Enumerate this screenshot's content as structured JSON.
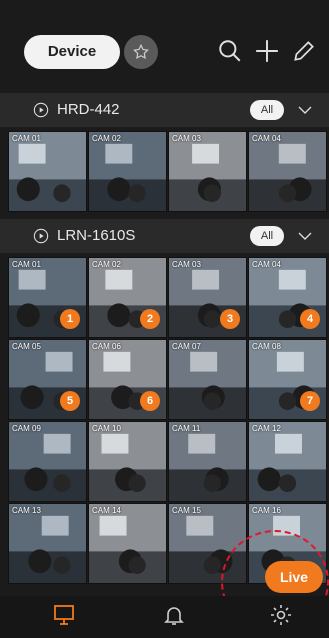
{
  "header": {
    "device_label": "Device",
    "icons": [
      "star-icon",
      "search-icon",
      "plus-icon",
      "pencil-icon"
    ]
  },
  "groups": [
    {
      "name": "HRD-442",
      "all_label": "All",
      "cameras": [
        {
          "label": "CAM 01",
          "badge": ""
        },
        {
          "label": "CAM 02",
          "badge": ""
        },
        {
          "label": "CAM 03",
          "badge": ""
        },
        {
          "label": "CAM 04",
          "badge": ""
        }
      ]
    },
    {
      "name": "LRN-1610S",
      "all_label": "All",
      "cameras": [
        {
          "label": "CAM 01",
          "badge": "1"
        },
        {
          "label": "CAM 02",
          "badge": "2"
        },
        {
          "label": "CAM 03",
          "badge": "3"
        },
        {
          "label": "CAM 04",
          "badge": "4"
        },
        {
          "label": "CAM 05",
          "badge": "5"
        },
        {
          "label": "CAM 06",
          "badge": "6"
        },
        {
          "label": "CAM 07",
          "badge": ""
        },
        {
          "label": "CAM 08",
          "badge": "7"
        },
        {
          "label": "CAM 09",
          "badge": ""
        },
        {
          "label": "CAM 10",
          "badge": ""
        },
        {
          "label": "CAM 11",
          "badge": ""
        },
        {
          "label": "CAM 12",
          "badge": ""
        },
        {
          "label": "CAM 13",
          "badge": ""
        },
        {
          "label": "CAM 14",
          "badge": ""
        },
        {
          "label": "CAM 15",
          "badge": ""
        },
        {
          "label": "CAM 16",
          "badge": ""
        }
      ]
    }
  ],
  "live_label": "Live",
  "tabbar": {
    "tabs": [
      "monitor-icon",
      "bell-icon",
      "gear-icon"
    ]
  },
  "colors": {
    "accent": "#f07a1d",
    "highlight": "#e0162b",
    "background": "#1b1b1b"
  }
}
